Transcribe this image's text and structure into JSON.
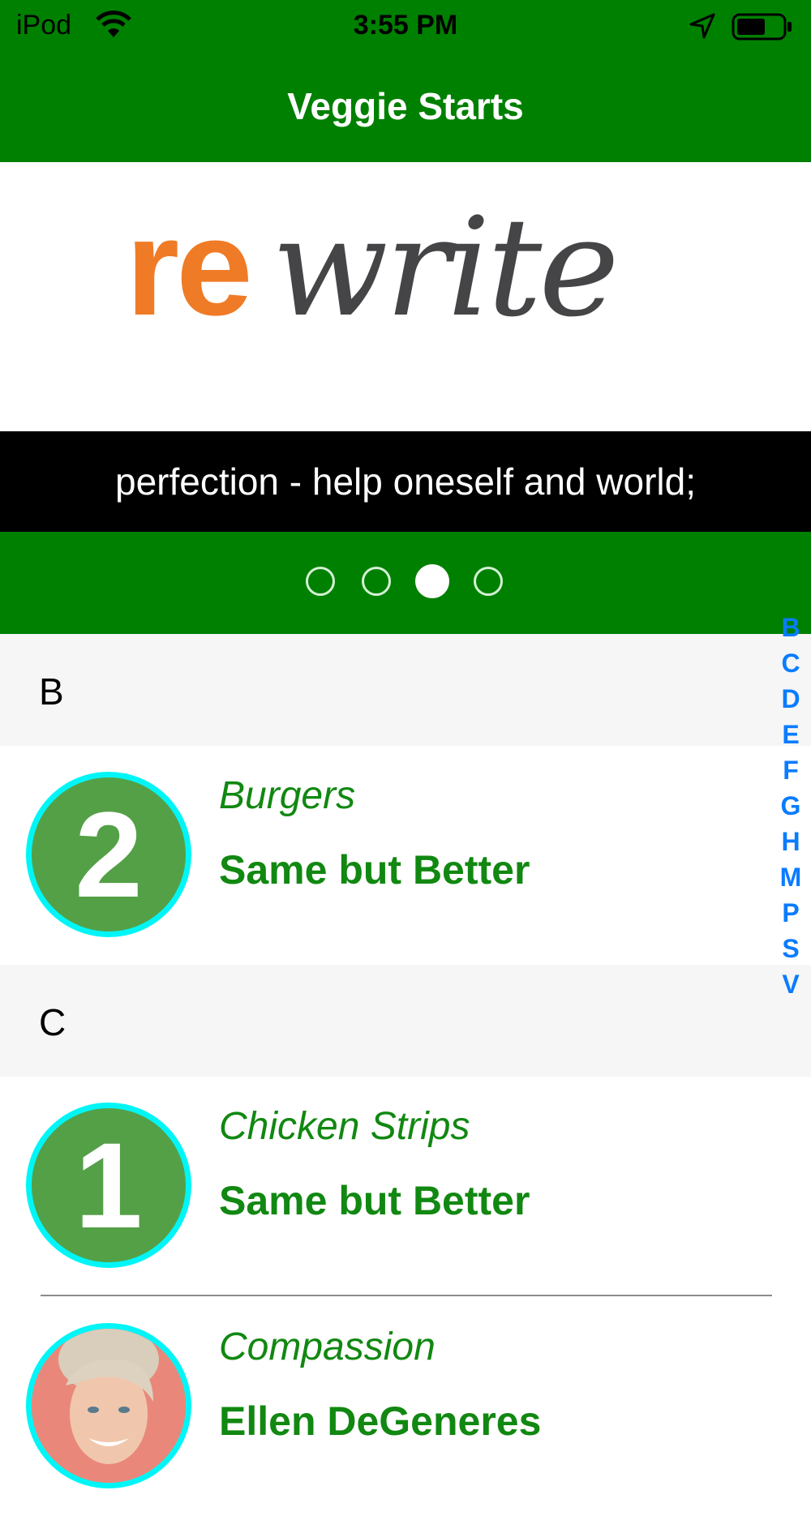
{
  "status_bar": {
    "carrier": "iPod",
    "time": "3:55 PM"
  },
  "nav": {
    "title": "Veggie Starts"
  },
  "banner": {
    "logo_text_1": "re",
    "logo_text_2": "write",
    "caption": "perfection - help oneself and world;",
    "page_count": 4,
    "current_page_index": 2
  },
  "index_letters": [
    "B",
    "C",
    "D",
    "E",
    "F",
    "G",
    "H",
    "M",
    "P",
    "S",
    "V"
  ],
  "sections": [
    {
      "header": "B",
      "rows": [
        {
          "badge": "2",
          "category": "Burgers",
          "subtitle": "Same but Better"
        }
      ]
    },
    {
      "header": "C",
      "rows": [
        {
          "badge": "1",
          "category": "Chicken Strips",
          "subtitle": "Same but Better"
        },
        {
          "badge": "",
          "category": "Compassion",
          "subtitle": "Ellen DeGeneres"
        }
      ]
    }
  ],
  "colors": {
    "nav_green": "#008000",
    "text_green": "#118811",
    "badge_green": "#54a047",
    "badge_ring": "#00f6f6",
    "index_blue": "#0a7cff",
    "logo_orange": "#ef7b26",
    "logo_gray": "#454547"
  },
  "icons": [
    "wifi-icon",
    "location-arrow-icon",
    "battery-icon"
  ]
}
